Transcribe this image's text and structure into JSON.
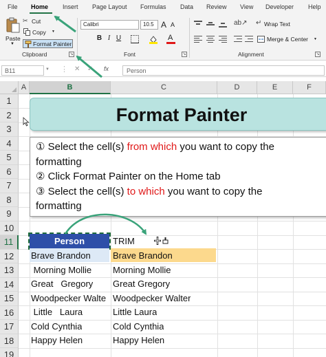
{
  "ribbon": {
    "tabs": [
      "File",
      "Home",
      "Insert",
      "Page Layout",
      "Formulas",
      "Data",
      "Review",
      "View",
      "Developer",
      "Help"
    ],
    "active_tab": "Home",
    "clipboard": {
      "paste": "Paste",
      "cut": "Cut",
      "copy": "Copy",
      "format_painter": "Format Painter",
      "group_label": "Clipboard"
    },
    "font": {
      "font_name": "Calibri",
      "font_size": "10.5",
      "grow": "A",
      "shrink": "A",
      "bold": "B",
      "italic": "I",
      "underline": "U",
      "font_color_letter": "A",
      "group_label": "Font"
    },
    "alignment": {
      "wrap_text": "Wrap Text",
      "merge_center": "Merge & Center",
      "group_label": "Alignment"
    }
  },
  "formula_bar": {
    "name_box": "B11",
    "fx": "fx",
    "value": "Person"
  },
  "grid": {
    "columns": [
      "A",
      "B",
      "C",
      "D",
      "E",
      "F"
    ],
    "rows": [
      "1",
      "2",
      "3",
      "4",
      "5",
      "6",
      "7",
      "8",
      "9",
      "10",
      "11",
      "12",
      "13",
      "14",
      "15",
      "16",
      "17",
      "18",
      "19"
    ],
    "selected_column": "B",
    "selected_row": "11"
  },
  "banner": {
    "title": "Format Painter"
  },
  "instructions": {
    "step1_num": "①",
    "step1_a": " Select the cell(s) ",
    "step1_red": "from which",
    "step1_b": " you want to copy the",
    "step1_c": "formatting",
    "step2_num": "②",
    "step2_text": " Click Format Painter on the Home tab",
    "step3_num": "③",
    "step3_a": " Select the cell(s) ",
    "step3_red": "to which",
    "step3_b": " you want to copy the",
    "step3_c": "formatting"
  },
  "table": {
    "b_header": "Person",
    "c_header": "TRIM",
    "b_values": [
      "Brave Brandon",
      " Morning Mollie",
      "Great   Gregory",
      "Woodpecker Walte",
      " Little   Laura",
      "Cold Cynthia",
      "Happy Helen"
    ],
    "c_values": [
      "Brave Brandon",
      "Morning Mollie",
      "Great Gregory",
      "Woodpecker Walter",
      "Little Laura",
      "Cold Cynthia",
      "Happy Helen"
    ]
  },
  "colors": {
    "accent": "#217346",
    "banner_bg": "#b9e3e0",
    "header_cell_bg": "#2e4fa8",
    "highlight_cell_bg": "#fcd98d",
    "arrow": "#3aa37a"
  },
  "icons": [
    "scissors-icon",
    "copy-icon",
    "paintbrush-icon",
    "paste-icon",
    "fill-color-icon",
    "borders-icon",
    "wrap-text-icon",
    "merge-icon",
    "paintbrush-cursor-icon"
  ]
}
